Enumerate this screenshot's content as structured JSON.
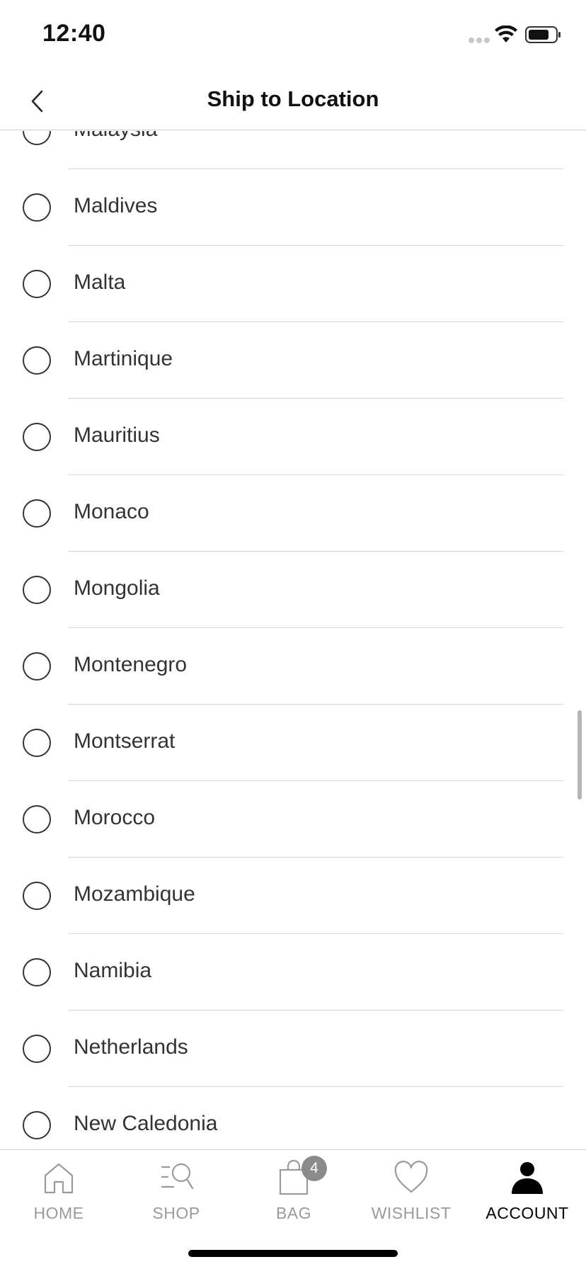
{
  "status_bar": {
    "time": "12:40"
  },
  "header": {
    "title": "Ship to Location"
  },
  "countries": [
    "Malaysia",
    "Maldives",
    "Malta",
    "Martinique",
    "Mauritius",
    "Monaco",
    "Mongolia",
    "Montenegro",
    "Montserrat",
    "Morocco",
    "Mozambique",
    "Namibia",
    "Netherlands",
    "New Caledonia"
  ],
  "tabs": [
    {
      "label": "HOME",
      "icon": "home-icon",
      "active": false
    },
    {
      "label": "SHOP",
      "icon": "shop-search-icon",
      "active": false
    },
    {
      "label": "BAG",
      "icon": "bag-icon",
      "active": false,
      "badge": "4"
    },
    {
      "label": "WISHLIST",
      "icon": "heart-icon",
      "active": false
    },
    {
      "label": "ACCOUNT",
      "icon": "person-icon",
      "active": true
    }
  ],
  "colors": {
    "active_tab": "#000000",
    "inactive_tab": "#9a9a9a",
    "badge": "#8a8a8a"
  }
}
